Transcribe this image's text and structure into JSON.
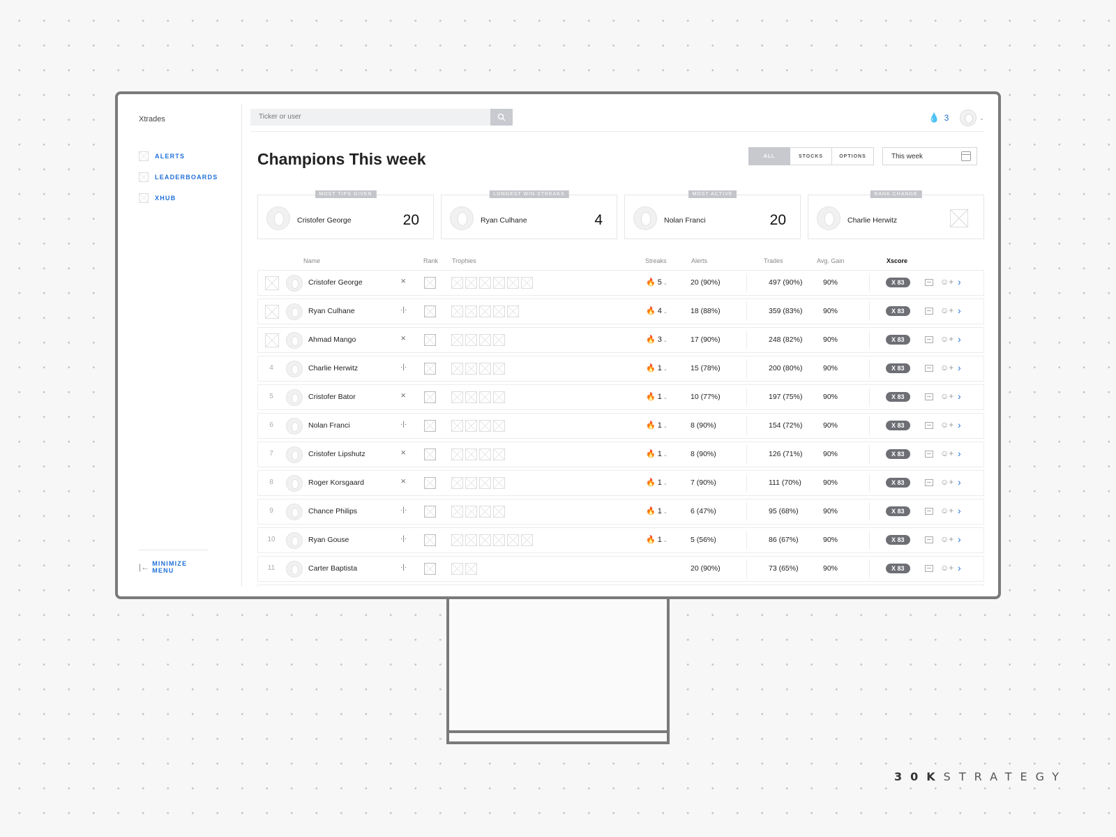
{
  "app": {
    "logo": "Xtrades"
  },
  "sidebar": {
    "items": [
      {
        "label": "ALERTS"
      },
      {
        "label": "LEADERBOARDS"
      },
      {
        "label": "XHUB"
      }
    ],
    "minimize_label": "MINIMIZE MENU"
  },
  "search": {
    "placeholder": "Ticker or user"
  },
  "header": {
    "flame_count": "3"
  },
  "title": {
    "main": "Champions",
    "bold": "This week"
  },
  "filters": {
    "segments": [
      "ALL",
      "STOCKS",
      "OPTIONS"
    ],
    "active": "ALL",
    "date_value": "This week"
  },
  "cards": [
    {
      "label": "MOST TIPS GIVEN",
      "name": "Cristofer George",
      "value": "20"
    },
    {
      "label": "LONGEST WIN STREAKS",
      "name": "Ryan Culhane",
      "value": "4"
    },
    {
      "label": "MOST ACTIVE",
      "name": "Nolan Franci",
      "value": "20"
    },
    {
      "label": "RANK CHANGE",
      "name": "Charlie Herwitz",
      "value": ""
    }
  ],
  "table": {
    "columns": [
      "Name",
      "Rank",
      "Trophies",
      "Streaks",
      "Alerts",
      "Trades",
      "Avg. Gain",
      "Xscore"
    ],
    "rows": [
      {
        "rank": "",
        "name": "Cristofer George",
        "trend": "stocks",
        "trophies": 6,
        "streak": "5",
        "alerts": "20 (90%)",
        "trades": "497 (90%)",
        "gain": "90%",
        "xscore": "X 83"
      },
      {
        "rank": "",
        "name": "Ryan Culhane",
        "trend": "options",
        "trophies": 5,
        "streak": "4",
        "alerts": "18 (88%)",
        "trades": "359 (83%)",
        "gain": "90%",
        "xscore": "X 83"
      },
      {
        "rank": "",
        "name": "Ahmad Mango",
        "trend": "stocks",
        "trophies": 4,
        "streak": "3",
        "alerts": "17 (90%)",
        "trades": "248 (82%)",
        "gain": "90%",
        "xscore": "X 83"
      },
      {
        "rank": "4",
        "name": "Charlie Herwitz",
        "trend": "options",
        "trophies": 4,
        "streak": "1",
        "alerts": "15 (78%)",
        "trades": "200 (80%)",
        "gain": "90%",
        "xscore": "X 83"
      },
      {
        "rank": "5",
        "name": "Cristofer Bator",
        "trend": "stocks",
        "trophies": 4,
        "streak": "1",
        "alerts": "10 (77%)",
        "trades": "197 (75%)",
        "gain": "90%",
        "xscore": "X 83"
      },
      {
        "rank": "6",
        "name": "Nolan Franci",
        "trend": "options",
        "trophies": 4,
        "streak": "1",
        "alerts": "8 (90%)",
        "trades": "154 (72%)",
        "gain": "90%",
        "xscore": "X 83"
      },
      {
        "rank": "7",
        "name": "Cristofer Lipshutz",
        "trend": "stocks",
        "trophies": 4,
        "streak": "1",
        "alerts": "8 (90%)",
        "trades": "126 (71%)",
        "gain": "90%",
        "xscore": "X 83"
      },
      {
        "rank": "8",
        "name": "Roger Korsgaard",
        "trend": "stocks",
        "trophies": 4,
        "streak": "1",
        "alerts": "7 (90%)",
        "trades": "111 (70%)",
        "gain": "90%",
        "xscore": "X 83"
      },
      {
        "rank": "9",
        "name": "Chance Philips",
        "trend": "options",
        "trophies": 4,
        "streak": "1",
        "alerts": "6 (47%)",
        "trades": "95 (68%)",
        "gain": "90%",
        "xscore": "X 83"
      },
      {
        "rank": "10",
        "name": "Ryan Gouse",
        "trend": "options",
        "trophies": 6,
        "streak": "1",
        "alerts": "5 (56%)",
        "trades": "86 (67%)",
        "gain": "90%",
        "xscore": "X 83"
      },
      {
        "rank": "11",
        "name": "Carter Baptista",
        "trend": "options",
        "trophies": 2,
        "streak": "",
        "alerts": "20 (90%)",
        "trades": "73 (65%)",
        "gain": "90%",
        "xscore": "X 83"
      }
    ]
  },
  "footer_brand": {
    "bold": "30K",
    "rest": "STRATEGY"
  },
  "colors": {
    "accent": "#1f6fd8",
    "xscore_badge": "#6d6f75",
    "segment_active": "#c7c9ce"
  }
}
